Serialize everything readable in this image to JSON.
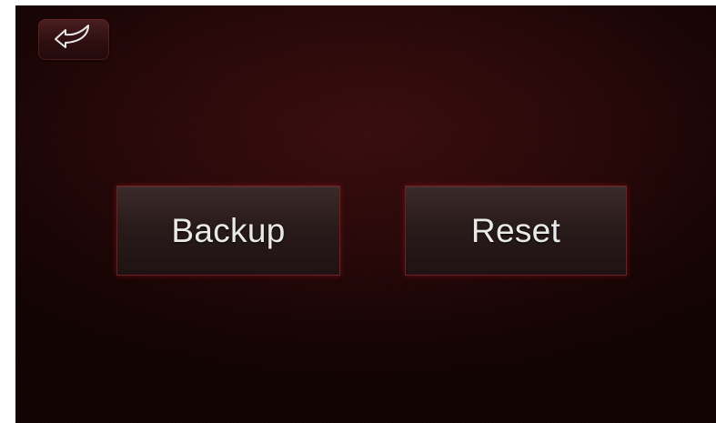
{
  "header": {
    "back_icon": "back-arrow-icon"
  },
  "main": {
    "backup_label": "Backup",
    "reset_label": "Reset"
  },
  "colors": {
    "background": "#2a0809",
    "button_border": "#6e1f22",
    "label_text": "#e9e9e9"
  }
}
